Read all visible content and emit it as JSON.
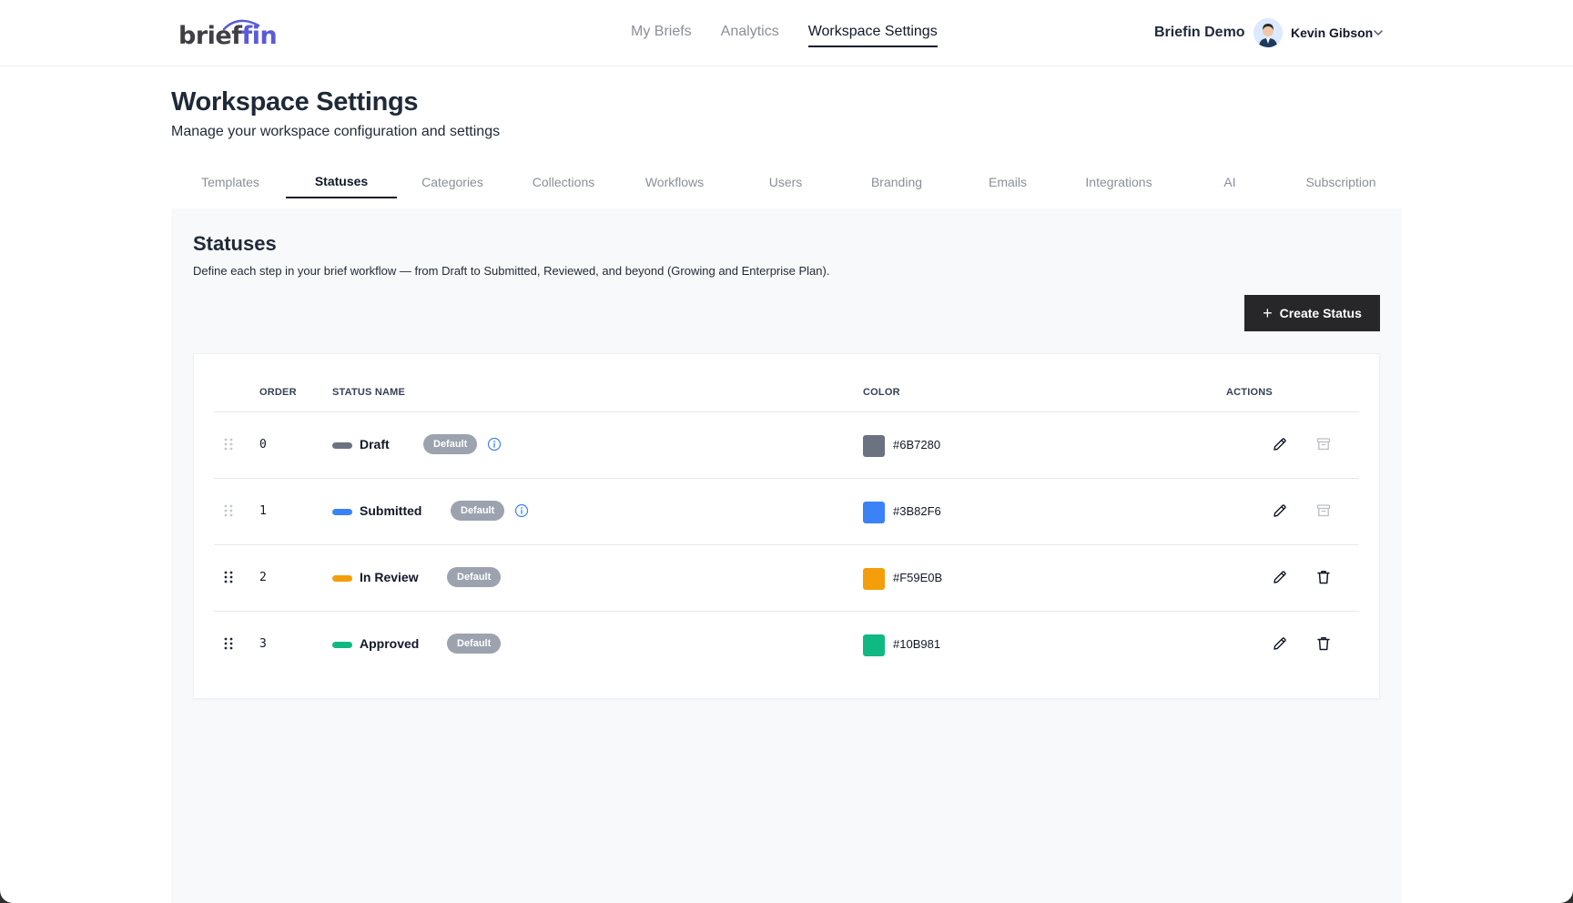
{
  "app": {
    "logo_text_main": "brief",
    "logo_text_accent": "in",
    "nav": [
      "My Briefs",
      "Analytics",
      "Workspace Settings"
    ],
    "workspace_name": "Briefin Demo",
    "user_name": "Kevin Gibson"
  },
  "header": {
    "title": "Workspace Settings",
    "subtitle": "Manage your workspace configuration and settings"
  },
  "tabs": [
    "Templates",
    "Statuses",
    "Categories",
    "Collections",
    "Workflows",
    "Users",
    "Branding",
    "Emails",
    "Integrations",
    "AI",
    "Subscription"
  ],
  "active_tab": "Statuses",
  "statuses_panel": {
    "title": "Statuses",
    "description": "Define each step in your brief workflow — from Draft to Submitted, Reviewed, and beyond (Growing and Enterprise Plan).",
    "create_button": "Create Status"
  },
  "table": {
    "columns": {
      "order": "ORDER",
      "status_name": "STATUS NAME",
      "color": "COLOR",
      "actions": "ACTIONS"
    },
    "rows": [
      {
        "order": "0",
        "name": "Draft",
        "badge": "Default",
        "color": "#6B7280",
        "has_info": true,
        "delete_icon": "archive-icon",
        "delete_enabled": false
      },
      {
        "order": "1",
        "name": "Submitted",
        "badge": "Default",
        "color": "#3B82F6",
        "has_info": true,
        "delete_icon": "archive-icon",
        "delete_enabled": false
      },
      {
        "order": "2",
        "name": "In Review",
        "badge": "Default",
        "color": "#F59E0B",
        "has_info": false,
        "delete_icon": "trash-icon",
        "delete_enabled": true
      },
      {
        "order": "3",
        "name": "Approved",
        "badge": "Default",
        "color": "#10B981",
        "has_info": false,
        "delete_icon": "trash-icon",
        "delete_enabled": true
      }
    ]
  },
  "colors": {
    "accent": "#5b5bd6",
    "button_dark": "#27272a",
    "badge": "#9ca3af",
    "info": "#3b82f6"
  }
}
